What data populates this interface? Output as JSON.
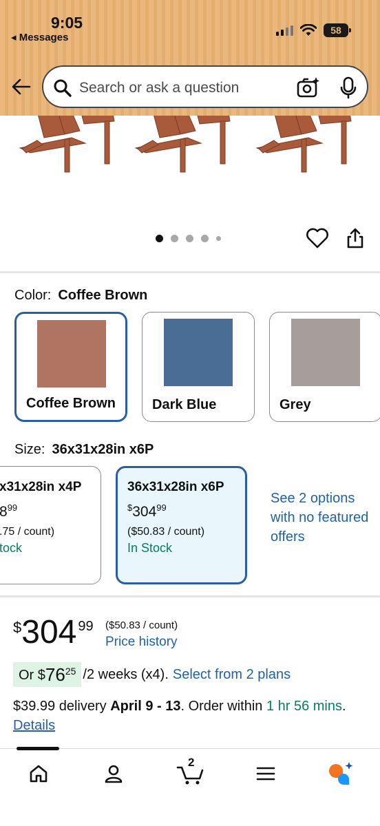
{
  "status_bar": {
    "time": "9:05",
    "back_app": "◂ Messages",
    "battery": "58"
  },
  "search": {
    "placeholder": "Search or ask a question"
  },
  "gallery": {
    "image_count": 5,
    "active_index": 0
  },
  "color": {
    "label": "Color:",
    "selected": "Coffee Brown",
    "options": [
      {
        "name": "Coffee Brown",
        "hex": "#b07562"
      },
      {
        "name": "Dark Blue",
        "hex": "#4a6d96"
      },
      {
        "name": "Grey",
        "hex": "#a59e9b"
      }
    ]
  },
  "size": {
    "label": "Size:",
    "selected": "36x31x28in x6P",
    "options": [
      {
        "name": "x31x28in x4P",
        "price_whole": "8",
        "price_frac": "99",
        "count": ".75 / count)",
        "stock": "tock"
      },
      {
        "name": "36x31x28in x6P",
        "price_cur": "$",
        "price_whole": "304",
        "price_frac": "99",
        "count": "($50.83 / count)",
        "stock": "In Stock"
      }
    ],
    "see_options": "See 2 options with no featured offers"
  },
  "price": {
    "currency": "$",
    "whole": "304",
    "fraction": "99",
    "per_count": "($50.83 / count)",
    "history_link": "Price history"
  },
  "installment": {
    "prefix": "Or $",
    "amount_whole": "76",
    "amount_frac": "25",
    "suffix": "/2 weeks (x4).",
    "link": "Select from 2 plans"
  },
  "delivery": {
    "cost": "$39.99 delivery ",
    "dates": "April 9 - 13",
    "order_within": ". Order within ",
    "time_left": "1 hr 56 mins",
    "end": ".",
    "details_link": "Details"
  },
  "nav": {
    "cart_count": "2"
  },
  "colors": {
    "accent_blue": "#2a5ea0",
    "link_blue": "#2162a1",
    "stock_green": "#067d62",
    "header_orange": "#eab87c"
  }
}
